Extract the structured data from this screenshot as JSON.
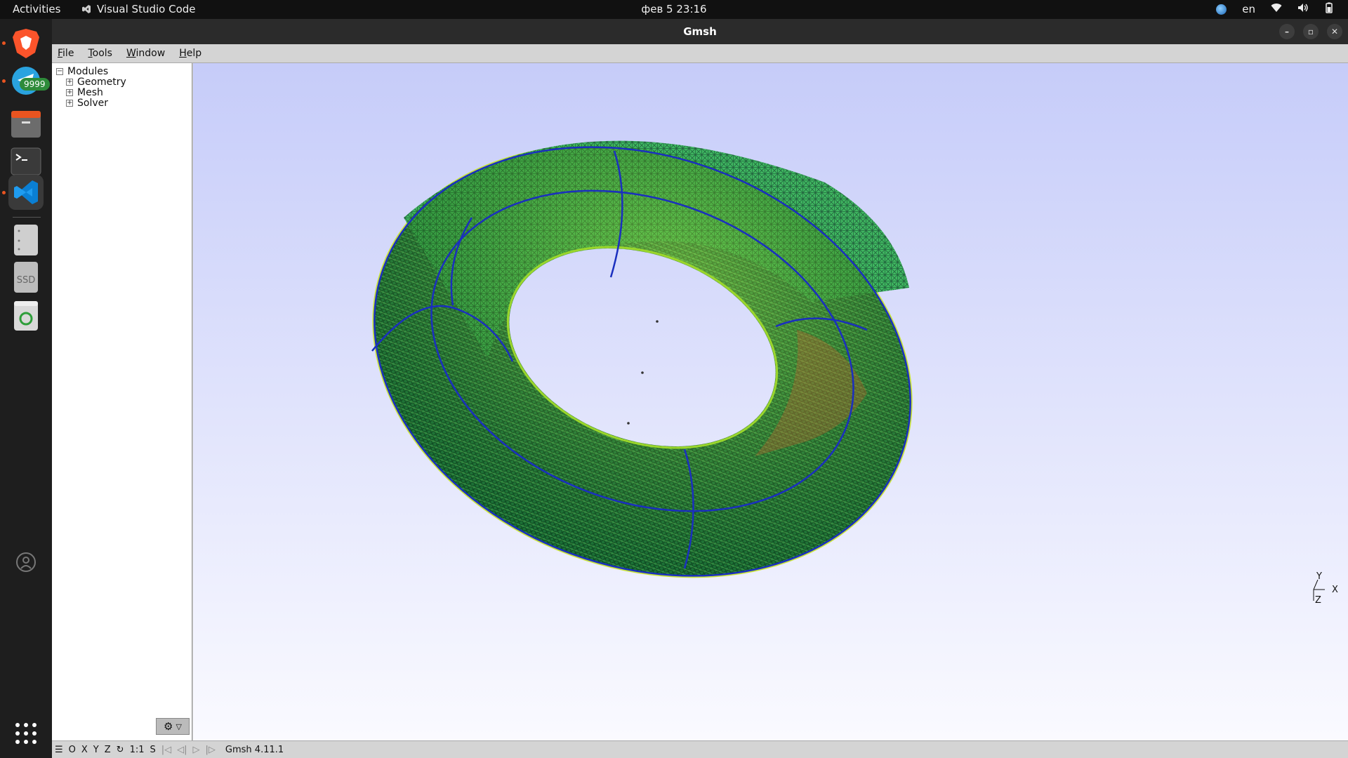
{
  "topbar": {
    "activities": "Activities",
    "app_name": "Visual Studio Code",
    "clock": "фев 5  23:16",
    "lang": "en"
  },
  "dock": {
    "telegram_badge": "9999",
    "ssd_label": "SSD"
  },
  "window": {
    "title": "Gmsh"
  },
  "menu": [
    "File",
    "Tools",
    "Window",
    "Help"
  ],
  "tree": {
    "root": "Modules",
    "children": [
      "Geometry",
      "Mesh",
      "Solver"
    ]
  },
  "status": {
    "axes": [
      "O",
      "X",
      "Y",
      "Z"
    ],
    "scale": "1:1",
    "s": "S",
    "version": "Gmsh 4.11.1"
  },
  "axis_gizmo": {
    "y": "Y",
    "x": "X",
    "z": "Z"
  },
  "colors": {
    "mesh_green": "#2fb34f",
    "mesh_dark": "#0f5a2a",
    "curve_blue": "#1a2fbf",
    "ubuntu_orange": "#e95420"
  }
}
